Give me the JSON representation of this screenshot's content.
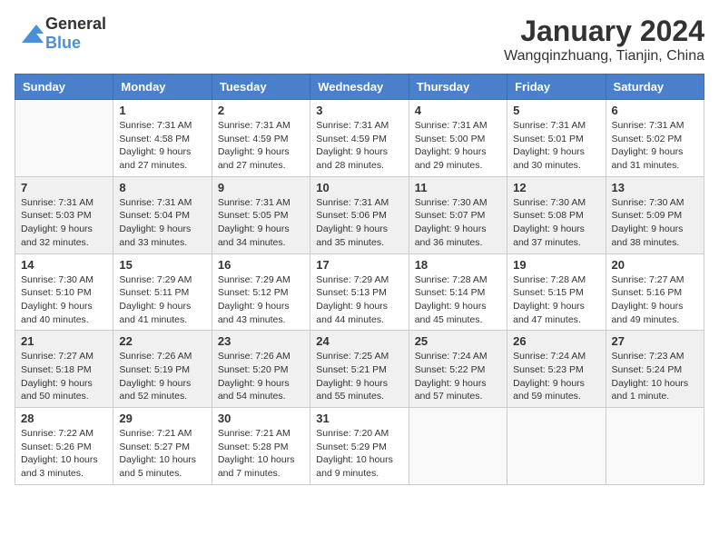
{
  "header": {
    "logo_general": "General",
    "logo_blue": "Blue",
    "month_year": "January 2024",
    "location": "Wangqinzhuang, Tianjin, China"
  },
  "weekdays": [
    "Sunday",
    "Monday",
    "Tuesday",
    "Wednesday",
    "Thursday",
    "Friday",
    "Saturday"
  ],
  "weeks": [
    [
      {
        "day": "",
        "sunrise": "",
        "sunset": "",
        "daylight": ""
      },
      {
        "day": "1",
        "sunrise": "Sunrise: 7:31 AM",
        "sunset": "Sunset: 4:58 PM",
        "daylight": "Daylight: 9 hours and 27 minutes."
      },
      {
        "day": "2",
        "sunrise": "Sunrise: 7:31 AM",
        "sunset": "Sunset: 4:59 PM",
        "daylight": "Daylight: 9 hours and 27 minutes."
      },
      {
        "day": "3",
        "sunrise": "Sunrise: 7:31 AM",
        "sunset": "Sunset: 4:59 PM",
        "daylight": "Daylight: 9 hours and 28 minutes."
      },
      {
        "day": "4",
        "sunrise": "Sunrise: 7:31 AM",
        "sunset": "Sunset: 5:00 PM",
        "daylight": "Daylight: 9 hours and 29 minutes."
      },
      {
        "day": "5",
        "sunrise": "Sunrise: 7:31 AM",
        "sunset": "Sunset: 5:01 PM",
        "daylight": "Daylight: 9 hours and 30 minutes."
      },
      {
        "day": "6",
        "sunrise": "Sunrise: 7:31 AM",
        "sunset": "Sunset: 5:02 PM",
        "daylight": "Daylight: 9 hours and 31 minutes."
      }
    ],
    [
      {
        "day": "7",
        "sunrise": "Sunrise: 7:31 AM",
        "sunset": "Sunset: 5:03 PM",
        "daylight": "Daylight: 9 hours and 32 minutes."
      },
      {
        "day": "8",
        "sunrise": "Sunrise: 7:31 AM",
        "sunset": "Sunset: 5:04 PM",
        "daylight": "Daylight: 9 hours and 33 minutes."
      },
      {
        "day": "9",
        "sunrise": "Sunrise: 7:31 AM",
        "sunset": "Sunset: 5:05 PM",
        "daylight": "Daylight: 9 hours and 34 minutes."
      },
      {
        "day": "10",
        "sunrise": "Sunrise: 7:31 AM",
        "sunset": "Sunset: 5:06 PM",
        "daylight": "Daylight: 9 hours and 35 minutes."
      },
      {
        "day": "11",
        "sunrise": "Sunrise: 7:30 AM",
        "sunset": "Sunset: 5:07 PM",
        "daylight": "Daylight: 9 hours and 36 minutes."
      },
      {
        "day": "12",
        "sunrise": "Sunrise: 7:30 AM",
        "sunset": "Sunset: 5:08 PM",
        "daylight": "Daylight: 9 hours and 37 minutes."
      },
      {
        "day": "13",
        "sunrise": "Sunrise: 7:30 AM",
        "sunset": "Sunset: 5:09 PM",
        "daylight": "Daylight: 9 hours and 38 minutes."
      }
    ],
    [
      {
        "day": "14",
        "sunrise": "Sunrise: 7:30 AM",
        "sunset": "Sunset: 5:10 PM",
        "daylight": "Daylight: 9 hours and 40 minutes."
      },
      {
        "day": "15",
        "sunrise": "Sunrise: 7:29 AM",
        "sunset": "Sunset: 5:11 PM",
        "daylight": "Daylight: 9 hours and 41 minutes."
      },
      {
        "day": "16",
        "sunrise": "Sunrise: 7:29 AM",
        "sunset": "Sunset: 5:12 PM",
        "daylight": "Daylight: 9 hours and 43 minutes."
      },
      {
        "day": "17",
        "sunrise": "Sunrise: 7:29 AM",
        "sunset": "Sunset: 5:13 PM",
        "daylight": "Daylight: 9 hours and 44 minutes."
      },
      {
        "day": "18",
        "sunrise": "Sunrise: 7:28 AM",
        "sunset": "Sunset: 5:14 PM",
        "daylight": "Daylight: 9 hours and 45 minutes."
      },
      {
        "day": "19",
        "sunrise": "Sunrise: 7:28 AM",
        "sunset": "Sunset: 5:15 PM",
        "daylight": "Daylight: 9 hours and 47 minutes."
      },
      {
        "day": "20",
        "sunrise": "Sunrise: 7:27 AM",
        "sunset": "Sunset: 5:16 PM",
        "daylight": "Daylight: 9 hours and 49 minutes."
      }
    ],
    [
      {
        "day": "21",
        "sunrise": "Sunrise: 7:27 AM",
        "sunset": "Sunset: 5:18 PM",
        "daylight": "Daylight: 9 hours and 50 minutes."
      },
      {
        "day": "22",
        "sunrise": "Sunrise: 7:26 AM",
        "sunset": "Sunset: 5:19 PM",
        "daylight": "Daylight: 9 hours and 52 minutes."
      },
      {
        "day": "23",
        "sunrise": "Sunrise: 7:26 AM",
        "sunset": "Sunset: 5:20 PM",
        "daylight": "Daylight: 9 hours and 54 minutes."
      },
      {
        "day": "24",
        "sunrise": "Sunrise: 7:25 AM",
        "sunset": "Sunset: 5:21 PM",
        "daylight": "Daylight: 9 hours and 55 minutes."
      },
      {
        "day": "25",
        "sunrise": "Sunrise: 7:24 AM",
        "sunset": "Sunset: 5:22 PM",
        "daylight": "Daylight: 9 hours and 57 minutes."
      },
      {
        "day": "26",
        "sunrise": "Sunrise: 7:24 AM",
        "sunset": "Sunset: 5:23 PM",
        "daylight": "Daylight: 9 hours and 59 minutes."
      },
      {
        "day": "27",
        "sunrise": "Sunrise: 7:23 AM",
        "sunset": "Sunset: 5:24 PM",
        "daylight": "Daylight: 10 hours and 1 minute."
      }
    ],
    [
      {
        "day": "28",
        "sunrise": "Sunrise: 7:22 AM",
        "sunset": "Sunset: 5:26 PM",
        "daylight": "Daylight: 10 hours and 3 minutes."
      },
      {
        "day": "29",
        "sunrise": "Sunrise: 7:21 AM",
        "sunset": "Sunset: 5:27 PM",
        "daylight": "Daylight: 10 hours and 5 minutes."
      },
      {
        "day": "30",
        "sunrise": "Sunrise: 7:21 AM",
        "sunset": "Sunset: 5:28 PM",
        "daylight": "Daylight: 10 hours and 7 minutes."
      },
      {
        "day": "31",
        "sunrise": "Sunrise: 7:20 AM",
        "sunset": "Sunset: 5:29 PM",
        "daylight": "Daylight: 10 hours and 9 minutes."
      },
      {
        "day": "",
        "sunrise": "",
        "sunset": "",
        "daylight": ""
      },
      {
        "day": "",
        "sunrise": "",
        "sunset": "",
        "daylight": ""
      },
      {
        "day": "",
        "sunrise": "",
        "sunset": "",
        "daylight": ""
      }
    ]
  ]
}
